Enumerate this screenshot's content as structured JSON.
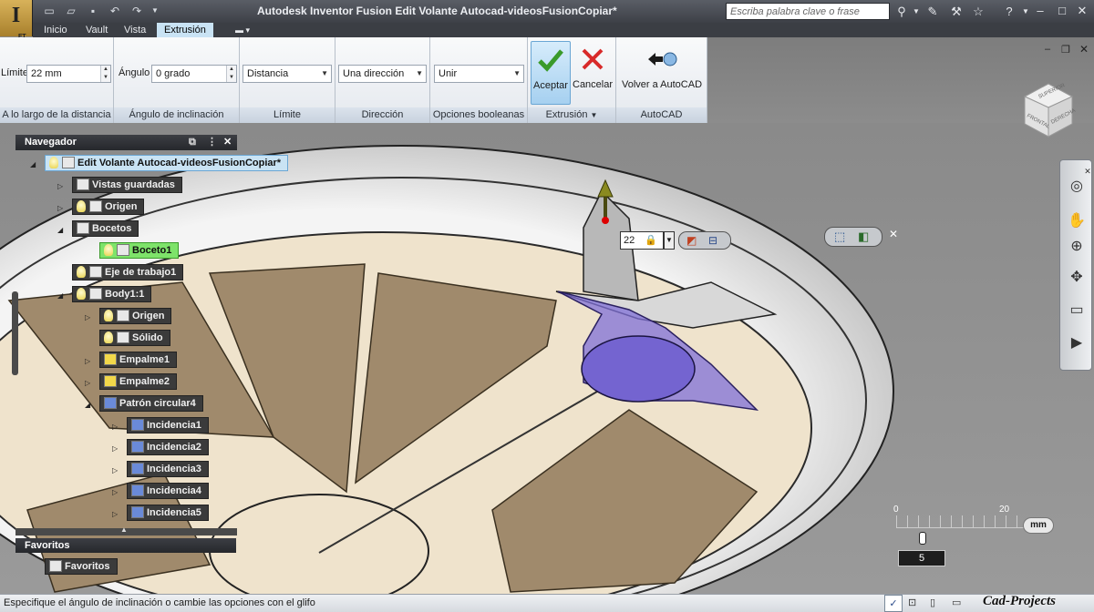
{
  "app": {
    "title": "Autodesk Inventor Fusion   Edit Volante Autocad-videosFusionCopiar*",
    "logo_text": "I",
    "logo_sub": "FT"
  },
  "search": {
    "placeholder": "Escriba palabra clave o frase"
  },
  "menu": {
    "items": [
      "Inicio",
      "Vault",
      "Vista",
      "Extrusión"
    ],
    "active": "Extrusión"
  },
  "ribbon": {
    "distance": {
      "label": "Límite",
      "value": "22 mm",
      "footer": "A lo largo de la distancia"
    },
    "angle": {
      "label": "Ángulo",
      "value": "0 grado",
      "footer": "Ángulo de inclinación"
    },
    "extent": {
      "value": "Distancia",
      "footer": "Límite"
    },
    "direction": {
      "value": "Una dirección",
      "footer": "Dirección"
    },
    "boolean": {
      "value": "Unir",
      "footer": "Opciones booleanas"
    },
    "extrusion": {
      "accept": "Aceptar",
      "cancel": "Cancelar",
      "footer": "Extrusión"
    },
    "autocad": {
      "back": "Volver a AutoCAD",
      "footer": "AutoCAD"
    }
  },
  "navigator": {
    "title": "Navegador",
    "root": "Edit Volante Autocad-videosFusionCopiar*",
    "nodes": {
      "saved_views": "Vistas guardadas",
      "origin": "Origen",
      "sketches": "Bocetos",
      "sketch1": "Boceto1",
      "work_axis": "Eje de trabajo1",
      "body": "Body1:1",
      "body_origin": "Origen",
      "solid": "Sólido",
      "fillet1": "Empalme1",
      "fillet2": "Empalme2",
      "circ_pattern": "Patrón circular4",
      "inc1": "Incidencia1",
      "inc2": "Incidencia2",
      "inc3": "Incidencia3",
      "inc4": "Incidencia4",
      "inc5": "Incidencia5"
    }
  },
  "favorites": {
    "title": "Favoritos",
    "item": "Favoritos"
  },
  "viewcube": {
    "top": "SUPERIOR",
    "front": "FRONTAL",
    "right": "DERECHA"
  },
  "manipulator": {
    "distance": "22"
  },
  "ruler": {
    "start": "0",
    "end": "20",
    "unit": "mm",
    "value": "5"
  },
  "status": {
    "message": "Especifique el ángulo de inclinación o cambie las opciones con el glifo"
  },
  "watermark": "Cad-Projects",
  "colors": {
    "accent": "#c9e3f4",
    "active_sketch": "#7ee36a",
    "profile": "#8070d8"
  }
}
